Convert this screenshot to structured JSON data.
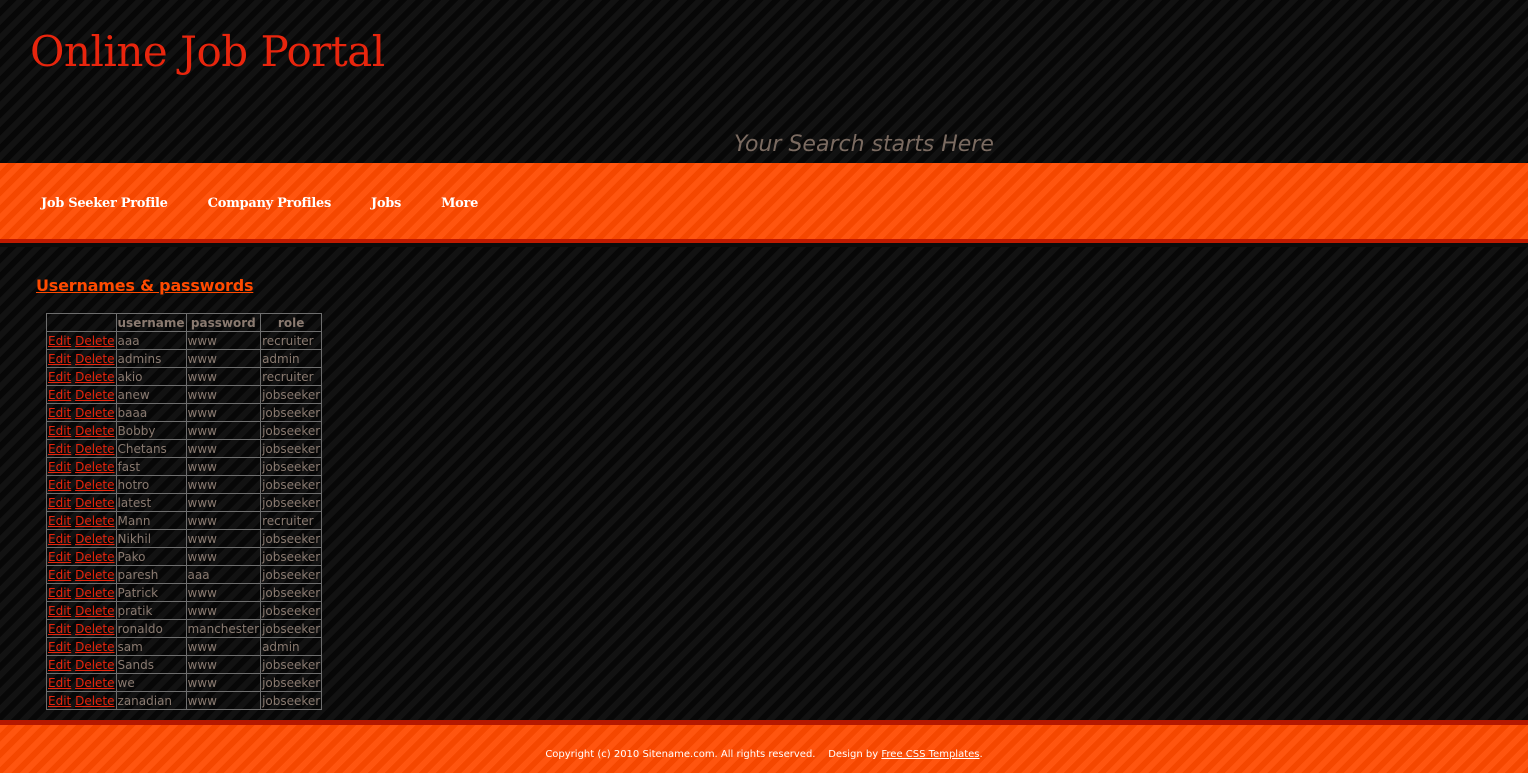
{
  "header": {
    "title": "Online Job Portal",
    "tagline": "Your Search starts Here"
  },
  "menu": {
    "items": [
      {
        "label": "Job Seeker Profile"
      },
      {
        "label": "Company Profiles"
      },
      {
        "label": "Jobs"
      },
      {
        "label": "More"
      }
    ]
  },
  "main": {
    "heading": "Usernames & passwords",
    "table": {
      "columns": [
        "",
        "username",
        "password",
        "role"
      ],
      "edit_label": "Edit",
      "delete_label": "Delete",
      "rows": [
        {
          "username": "aaa",
          "password": "www",
          "role": "recruiter"
        },
        {
          "username": "admins",
          "password": "www",
          "role": "admin"
        },
        {
          "username": "akio",
          "password": "www",
          "role": "recruiter"
        },
        {
          "username": "anew",
          "password": "www",
          "role": "jobseeker"
        },
        {
          "username": "baaa",
          "password": "www",
          "role": "jobseeker"
        },
        {
          "username": "Bobby",
          "password": "www",
          "role": "jobseeker"
        },
        {
          "username": "Chetans",
          "password": "www",
          "role": "jobseeker"
        },
        {
          "username": "fast",
          "password": "www",
          "role": "jobseeker"
        },
        {
          "username": "hotro",
          "password": "www",
          "role": "jobseeker"
        },
        {
          "username": "latest",
          "password": "www",
          "role": "jobseeker"
        },
        {
          "username": "Mann",
          "password": "www",
          "role": "recruiter"
        },
        {
          "username": "Nikhil",
          "password": "www",
          "role": "jobseeker"
        },
        {
          "username": "Pako",
          "password": "www",
          "role": "jobseeker"
        },
        {
          "username": "paresh",
          "password": "aaa",
          "role": "jobseeker"
        },
        {
          "username": "Patrick",
          "password": "www",
          "role": "jobseeker"
        },
        {
          "username": "pratik",
          "password": "www",
          "role": "jobseeker"
        },
        {
          "username": "ronaldo",
          "password": "manchester",
          "role": "jobseeker"
        },
        {
          "username": "sam",
          "password": "www",
          "role": "admin"
        },
        {
          "username": "Sands",
          "password": "www",
          "role": "jobseeker"
        },
        {
          "username": "we",
          "password": "www",
          "role": "jobseeker"
        },
        {
          "username": "zanadian",
          "password": "www",
          "role": "jobseeker"
        }
      ]
    }
  },
  "footer": {
    "copyright": "Copyright (c) 2010 Sitename.com. All rights reserved.",
    "design_prefix": "Design by",
    "design_link": "Free CSS Templates",
    "design_suffix": "."
  },
  "colors": {
    "accent": "#ff4a00",
    "title": "#e8250d",
    "background": "#0d0d0d"
  }
}
